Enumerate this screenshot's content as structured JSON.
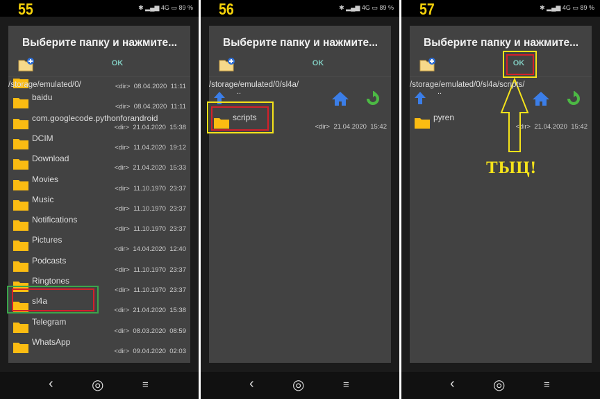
{
  "colors": {
    "step_number": "#f5d20a",
    "dialog_bg": "#424242",
    "ok": "#7fc8bd",
    "folder": "#fbbc12",
    "highlight_outer_green": "#3aa64a",
    "highlight_outer_yellow": "#f5e31a",
    "highlight_inner": "#d3202a",
    "home_icon": "#3b7ee8",
    "refresh_icon": "#4cb944"
  },
  "status": {
    "bluetooth_icon": "bluetooth-icon",
    "signal": "4G",
    "battery": "89 %"
  },
  "nav": {
    "back": "‹",
    "home": "◎",
    "menu": "≡"
  },
  "panels": [
    {
      "step": "55",
      "title": "Выберите папку и нажмите...",
      "ok_label": "OK",
      "path": "/storage/emulated/0/",
      "show_tools": false,
      "highlight": {
        "item": "sl4a",
        "outer": "green"
      },
      "items": [
        {
          "name": "",
          "date": "08.04.2020",
          "time": "11:11"
        },
        {
          "name": "baidu",
          "date": "08.04.2020",
          "time": "11:11"
        },
        {
          "name": "com.googlecode.pythonforandroid",
          "date": "21.04.2020",
          "time": "15:38"
        },
        {
          "name": "DCIM",
          "date": "11.04.2020",
          "time": "19:12"
        },
        {
          "name": "Download",
          "date": "21.04.2020",
          "time": "15:33"
        },
        {
          "name": "Movies",
          "date": "11.10.1970",
          "time": "23:37"
        },
        {
          "name": "Music",
          "date": "11.10.1970",
          "time": "23:37"
        },
        {
          "name": "Notifications",
          "date": "11.10.1970",
          "time": "23:37"
        },
        {
          "name": "Pictures",
          "date": "14.04.2020",
          "time": "12:40"
        },
        {
          "name": "Podcasts",
          "date": "11.10.1970",
          "time": "23:37"
        },
        {
          "name": "Ringtones",
          "date": "11.10.1970",
          "time": "23:37"
        },
        {
          "name": "sl4a",
          "date": "21.04.2020",
          "time": "15:38"
        },
        {
          "name": "Telegram",
          "date": "08.03.2020",
          "time": "08:59"
        },
        {
          "name": "WhatsApp",
          "date": "09.04.2020",
          "time": "02:03"
        }
      ]
    },
    {
      "step": "56",
      "title": "Выберите папку и нажмите...",
      "ok_label": "OK",
      "path": "/storage/emulated/0/sl4a/",
      "show_tools": true,
      "up_label": "..",
      "highlight": {
        "item": "scripts",
        "outer": "yellow"
      },
      "items": [
        {
          "name": "scripts",
          "date": "21.04.2020",
          "time": "15:42"
        }
      ]
    },
    {
      "step": "57",
      "title": "Выберите папку и нажмите...",
      "ok_label": "OK",
      "path": "/storage/emulated/0/sl4a/scripts/",
      "show_tools": true,
      "up_label": "..",
      "highlight_ok": true,
      "items": [
        {
          "name": "pyren",
          "date": "21.04.2020",
          "time": "15:42"
        }
      ]
    }
  ],
  "dir_label": "<dir>",
  "annotation": "ТЫЦ!"
}
